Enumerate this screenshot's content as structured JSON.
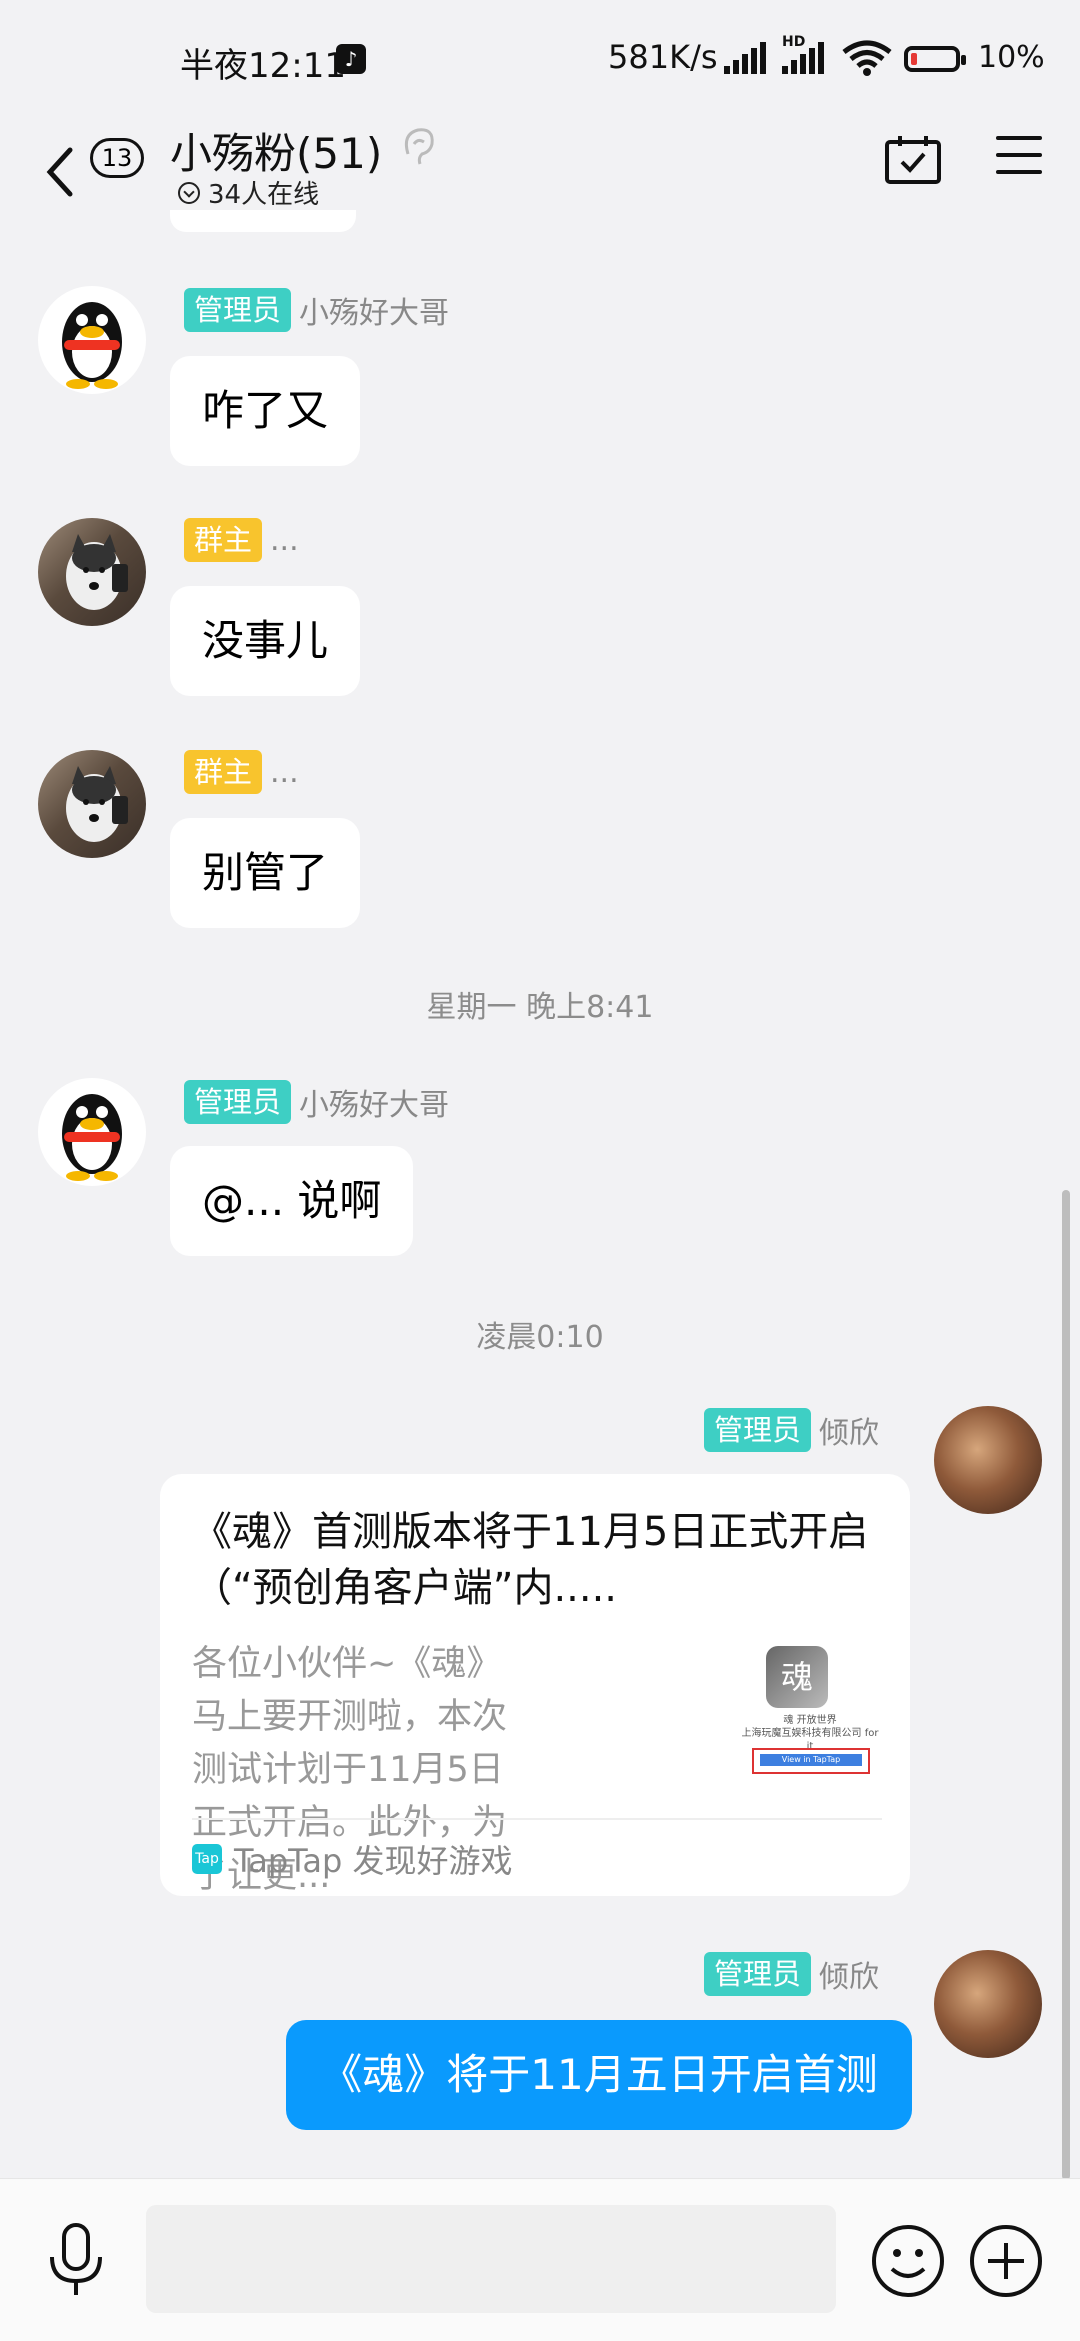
{
  "status_bar": {
    "time": "半夜12:11",
    "speed": "581K/s",
    "network_label": "HD",
    "battery": "10%",
    "battery_level": 0.1
  },
  "header": {
    "unread_count": "13",
    "group_title": "小殇粉(51)",
    "online": "34人在线"
  },
  "messages": [
    {
      "badge": "管理员",
      "name": "小殇好大哥",
      "text": "咋了又"
    },
    {
      "badge": "群主",
      "name": "...",
      "text": "没事儿"
    },
    {
      "badge": "群主",
      "name": "...",
      "text": "别管了"
    },
    {
      "badge": "管理员",
      "name": "小殇好大哥",
      "text": "@... 说啊"
    }
  ],
  "timestamps": [
    "星期一 晚上8:41",
    "凌晨0:10"
  ],
  "card_message": {
    "badge": "管理员",
    "name": "倾欣",
    "title": "《魂》首测版本将于11月5日正式开启（“预创角客户端”内.....",
    "description": "各位小伙伴~《魂》马上要开测啦，本次测试计划于11月5日正式开启。此外，为了让更...",
    "thumb_icon": "魂",
    "thumb_caption_1": "魂 开放世界",
    "thumb_caption_2": "上海玩魔互娱科技有限公司 for it",
    "thumb_button": "View in TapTap",
    "source_logo": "Tap",
    "source": "TapTap 发现好游戏"
  },
  "my_message": {
    "badge": "管理员",
    "name": "倾欣",
    "text": "《魂》将于11月五日开启首测"
  }
}
